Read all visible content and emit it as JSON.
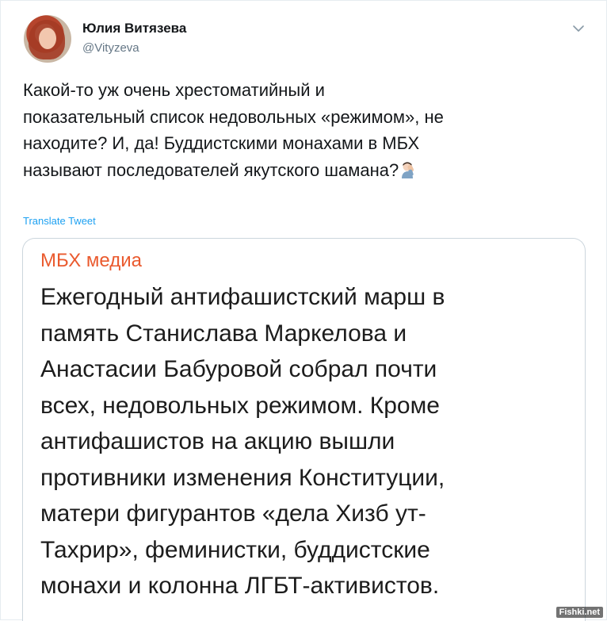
{
  "author": {
    "name": "Юлия Витязева",
    "handle": "@Vityzeva"
  },
  "icons": {
    "avatar": "avatar-photo",
    "menu": "chevron-down-icon",
    "emoji": "facepalm-emoji"
  },
  "tweet": {
    "lines": [
      "Какой-то уж очень хрестоматийный и",
      "показательный список недовольных «режимом», не",
      "находите? И, да! Буддистскими монахами в МБХ",
      "называют последователей якутского шамана?"
    ],
    "translate_label": "Translate Tweet"
  },
  "quote": {
    "source": "МБХ медиа",
    "lines": [
      "Ежегодный антифашистский марш в",
      "память Станислава Маркелова и",
      "Анастасии Бабуровой собрал почти",
      "всех, недовольных режимом. Кроме",
      "антифашистов на акцию вышли",
      "противники изменения Конституции,",
      "матери фигурантов «дела Хизб ут-",
      "Тахрир», феминистки, буддистские",
      "монахи и колонна ЛГБТ-активистов."
    ]
  },
  "watermark": "Fishki.net",
  "colors": {
    "accent": "#1da1f2",
    "quote_source": "#ea5a2e",
    "text": "#14171a",
    "muted": "#657786"
  }
}
